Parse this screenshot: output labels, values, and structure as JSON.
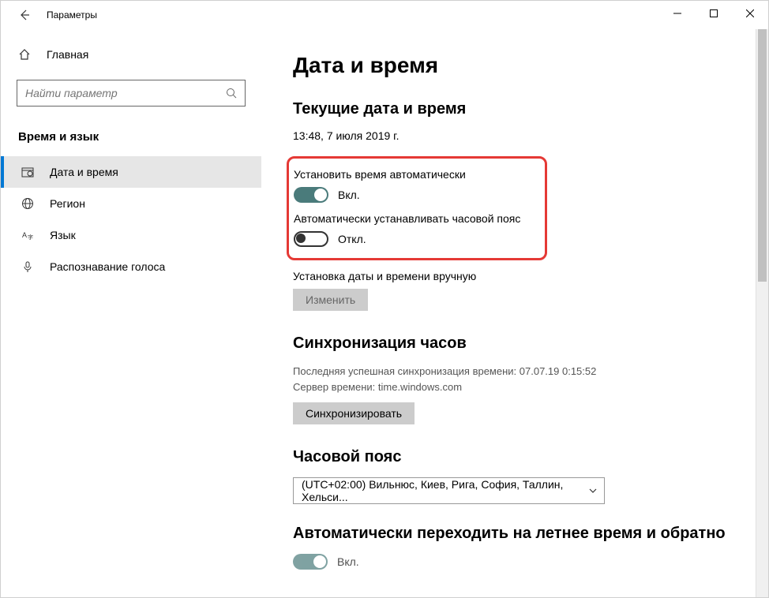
{
  "window": {
    "title": "Параметры"
  },
  "sidebar": {
    "home": "Главная",
    "search_placeholder": "Найти параметр",
    "category": "Время и язык",
    "items": [
      {
        "label": "Дата и время"
      },
      {
        "label": "Регион"
      },
      {
        "label": "Язык"
      },
      {
        "label": "Распознавание голоса"
      }
    ]
  },
  "main": {
    "title": "Дата и время",
    "current_heading": "Текущие дата и время",
    "current_value": "13:48, 7 июля 2019 г.",
    "auto_time_label": "Установить время автоматически",
    "auto_time_state": "Вкл.",
    "auto_tz_label": "Автоматически устанавливать часовой пояс",
    "auto_tz_state": "Откл.",
    "manual_heading": "Установка даты и времени вручную",
    "change_btn": "Изменить",
    "sync_heading": "Синхронизация часов",
    "sync_last": "Последняя успешная синхронизация времени: 07.07.19 0:15:52",
    "sync_server": "Сервер времени: time.windows.com",
    "sync_btn": "Синхронизировать",
    "tz_heading": "Часовой пояс",
    "tz_value": "(UTC+02:00) Вильнюс, Киев, Рига, София, Таллин, Хельси...",
    "dst_heading": "Автоматически переходить на летнее время и обратно",
    "dst_state": "Вкл."
  }
}
